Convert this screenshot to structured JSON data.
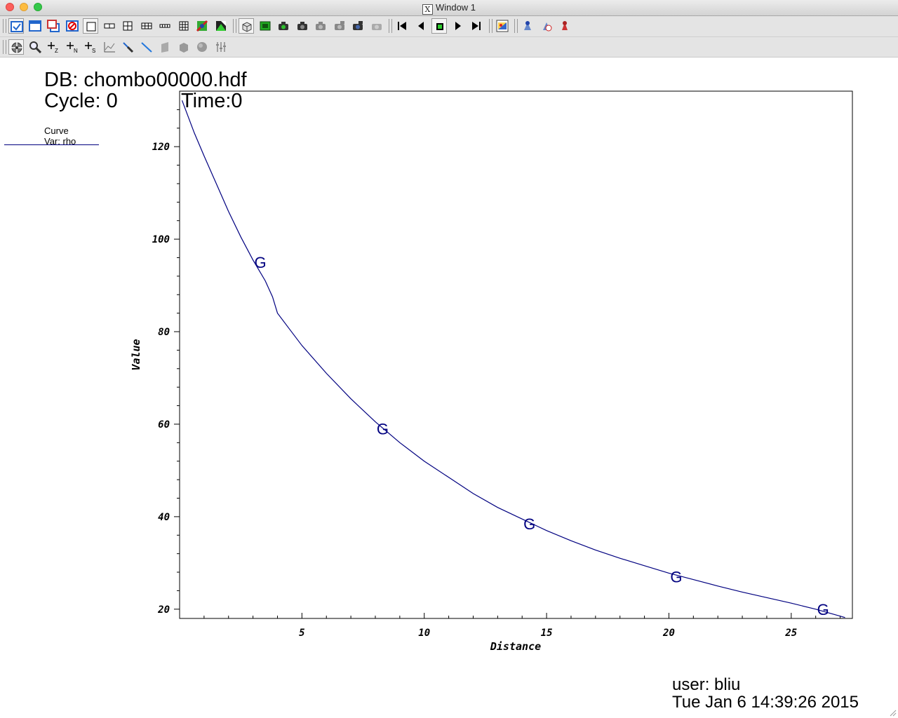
{
  "window": {
    "title": "Window 1"
  },
  "toolbar1": {
    "items": [
      {
        "name": "grip"
      },
      {
        "name": "active-window-icon",
        "pressed": true
      },
      {
        "name": "new-window-icon"
      },
      {
        "name": "copy-window-icon"
      },
      {
        "name": "clear-window-icon"
      },
      {
        "name": "layout-1x1-icon",
        "pressed": true
      },
      {
        "name": "layout-1x2-icon"
      },
      {
        "name": "layout-2x2-icon"
      },
      {
        "name": "layout-2x3-icon"
      },
      {
        "name": "layout-2x4-icon"
      },
      {
        "name": "layout-3x3-icon"
      },
      {
        "name": "lock-view-icon"
      },
      {
        "name": "lock-time-icon"
      },
      {
        "name": "grip"
      },
      {
        "name": "view-3d-icon",
        "pressed": true
      },
      {
        "name": "movie-icon"
      },
      {
        "name": "camera-add-icon"
      },
      {
        "name": "camera-icon"
      },
      {
        "name": "camera-disabled-1-icon"
      },
      {
        "name": "camera-disabled-2-icon"
      },
      {
        "name": "camera-2-icon"
      },
      {
        "name": "camera-disabled-3-icon"
      },
      {
        "name": "grip"
      },
      {
        "name": "rewind-icon"
      },
      {
        "name": "step-back-icon"
      },
      {
        "name": "stop-icon",
        "pressed": true
      },
      {
        "name": "play-icon"
      },
      {
        "name": "step-forward-icon"
      },
      {
        "name": "grip"
      },
      {
        "name": "invert-colors-icon"
      },
      {
        "name": "grip"
      },
      {
        "name": "spin-icon"
      },
      {
        "name": "spin-reset-icon"
      },
      {
        "name": "spin-stop-icon"
      }
    ]
  },
  "toolbar2": {
    "items": [
      {
        "name": "grip"
      },
      {
        "name": "navigate-icon",
        "pressed": true
      },
      {
        "name": "zoom-icon"
      },
      {
        "name": "zone-pick-icon",
        "sub": "Z"
      },
      {
        "name": "node-pick-icon",
        "sub": "N"
      },
      {
        "name": "spreadsheet-pick-icon",
        "sub": "S"
      },
      {
        "name": "curve-pick-icon"
      },
      {
        "name": "point-pick-icon"
      },
      {
        "name": "line-tool-icon"
      },
      {
        "name": "plane-tool-icon"
      },
      {
        "name": "box-tool-icon"
      },
      {
        "name": "sphere-tool-icon"
      },
      {
        "name": "axis-restriction-icon"
      }
    ]
  },
  "plot_text": {
    "db": "DB: chombo00000.hdf",
    "cycle": "Cycle: 0",
    "time": "Time:0",
    "legend_title": "Curve",
    "legend_var": "Var: rho",
    "user": "user: bliu",
    "date": "Tue Jan  6 14:39:26 2015",
    "marker_letter": "G"
  },
  "colors": {
    "curve": "#000080",
    "background": "#ffffff",
    "axis": "#000000"
  },
  "chart_data": {
    "type": "line",
    "xlabel": "Distance",
    "ylabel": "Value",
    "xlim": [
      0,
      27.5
    ],
    "ylim": [
      18,
      132
    ],
    "x_ticks": [
      5,
      10,
      15,
      20,
      25
    ],
    "y_ticks": [
      20,
      40,
      60,
      80,
      100,
      120
    ],
    "series": [
      {
        "x": [
          0.1,
          0.6,
          1.0,
          1.5,
          2.0,
          2.5,
          3.0,
          3.5,
          3.8,
          4.0,
          4.5,
          5.0,
          6.0,
          7.0,
          8.0,
          9.0,
          10.0,
          11.0,
          12.0,
          13.0,
          14.0,
          15.0,
          16.0,
          17.0,
          18.0,
          19.0,
          20.0,
          21.0,
          22.0,
          23.0,
          24.0,
          25.0,
          26.0,
          27.2
        ],
        "y": [
          130,
          123,
          118,
          112,
          106,
          100.5,
          95.5,
          91,
          87.5,
          84,
          80.5,
          77,
          71,
          65.5,
          60.5,
          56,
          52,
          48.5,
          45,
          42,
          39.5,
          37,
          34.8,
          32.8,
          31,
          29.4,
          27.8,
          26.4,
          25,
          23.7,
          22.5,
          21.3,
          20,
          18.2
        ]
      }
    ],
    "markers": [
      {
        "x": 3.3,
        "y": 95
      },
      {
        "x": 8.3,
        "y": 59
      },
      {
        "x": 14.3,
        "y": 38.5
      },
      {
        "x": 20.3,
        "y": 27
      },
      {
        "x": 26.3,
        "y": 20
      }
    ]
  }
}
